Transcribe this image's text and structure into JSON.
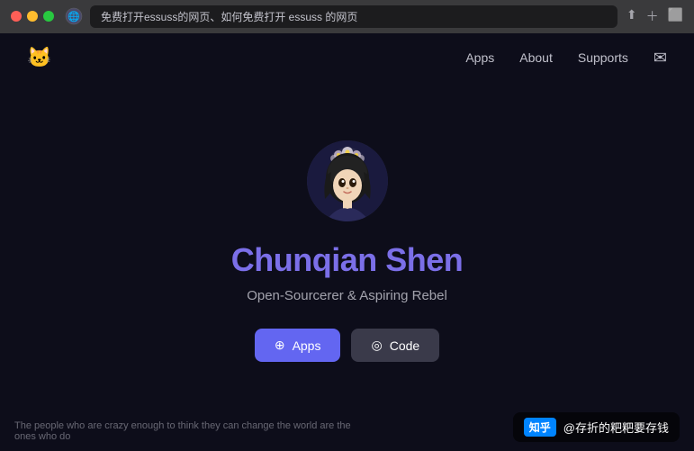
{
  "browser": {
    "url": "免费打开essuss的网页、如何免费打开 essuss 的网页",
    "traffic_lights": [
      "red",
      "yellow",
      "green"
    ]
  },
  "navbar": {
    "logo": "🐱",
    "links": [
      {
        "label": "Apps",
        "id": "nav-apps"
      },
      {
        "label": "About",
        "id": "nav-about"
      },
      {
        "label": "Supports",
        "id": "nav-supports"
      }
    ],
    "email_icon": "✉"
  },
  "hero": {
    "name": "Chunqian Shen",
    "subtitle": "Open-Sourcerer & Aspiring Rebel",
    "btn_apps": "Apps",
    "btn_code": "Code",
    "apps_icon": "⊕",
    "code_icon": "◎"
  },
  "footer": {
    "quote": "The people who are crazy enough to think they can change the world are the ones who do",
    "zhihu_label": "知乎",
    "zhihu_text": "@存折的粑粑要存钱"
  }
}
